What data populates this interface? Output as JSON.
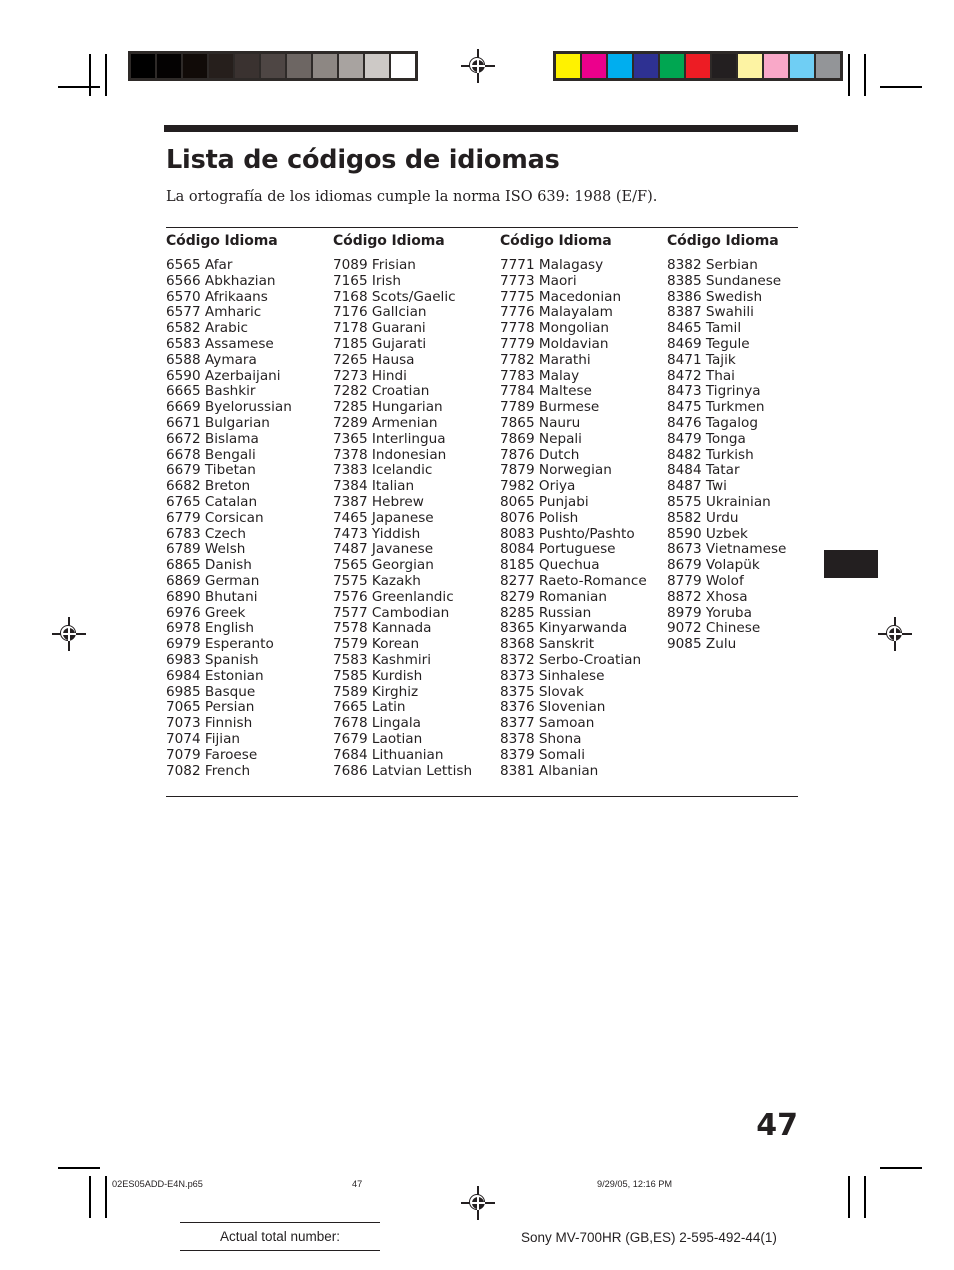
{
  "document": {
    "title": "Lista de códigos de idiomas",
    "intro": "La ortografía de los idiomas cumple la norma ISO 639: 1988 (E/F).",
    "folio": "47"
  },
  "table": {
    "headers": [
      "Código Idioma",
      "Código Idioma",
      "Código Idioma",
      "Código Idioma"
    ],
    "columns": [
      [
        "6565 Afar",
        "6566 Abkhazian",
        "6570 Afrikaans",
        "6577 Amharic",
        "6582 Arabic",
        "6583 Assamese",
        "6588 Aymara",
        "6590 Azerbaijani",
        "6665 Bashkir",
        "6669 Byelorussian",
        "6671 Bulgarian",
        "6672 Bislama",
        "6678 Bengali",
        "6679 Tibetan",
        "6682 Breton",
        "6765 Catalan",
        "6779 Corsican",
        "6783 Czech",
        "6789 Welsh",
        "6865 Danish",
        "6869 German",
        "6890 Bhutani",
        "6976 Greek",
        "6978 English",
        "6979 Esperanto",
        "6983 Spanish",
        "6984 Estonian",
        "6985 Basque",
        "7065 Persian",
        "7073 Finnish",
        "7074 Fijian",
        "7079 Faroese",
        "7082 French"
      ],
      [
        "7089 Frisian",
        "7165 Irish",
        "7168 Scots/Gaelic",
        "7176 Gallcian",
        "7178 Guarani",
        "7185 Gujarati",
        "7265 Hausa",
        "7273 Hindi",
        "7282 Croatian",
        "7285 Hungarian",
        "7289 Armenian",
        "7365 Interlingua",
        "7378 Indonesian",
        "7383 Icelandic",
        "7384 Italian",
        "7387 Hebrew",
        "7465 Japanese",
        "7473 Yiddish",
        "7487 Javanese",
        "7565 Georgian",
        "7575 Kazakh",
        "7576 Greenlandic",
        "7577 Cambodian",
        "7578 Kannada",
        "7579 Korean",
        "7583 Kashmiri",
        "7585 Kurdish",
        "7589 Kirghiz",
        "7665 Latin",
        "7678 Lingala",
        "7679 Laotian",
        "7684 Lithuanian",
        "7686 Latvian Lettish"
      ],
      [
        "7771 Malagasy",
        "7773 Maori",
        "7775 Macedonian",
        "7776 Malayalam",
        "7778 Mongolian",
        "7779 Moldavian",
        "7782 Marathi",
        "7783 Malay",
        "7784 Maltese",
        "7789 Burmese",
        "7865 Nauru",
        "7869 Nepali",
        "7876 Dutch",
        "7879 Norwegian",
        "7982 Oriya",
        "8065 Punjabi",
        "8076 Polish",
        "8083 Pushto/Pashto",
        "8084 Portuguese",
        "8185 Quechua",
        "8277 Raeto-Romance",
        "8279 Romanian",
        "8285 Russian",
        "8365 Kinyarwanda",
        "8368 Sanskrit",
        "8372 Serbo-Croatian",
        "8373 Sinhalese",
        "8375 Slovak",
        "8376 Slovenian",
        "8377 Samoan",
        "8378 Shona",
        "8379 Somali",
        "8381 Albanian"
      ],
      [
        "8382 Serbian",
        "8385 Sundanese",
        "8386 Swedish",
        "8387 Swahili",
        "8465 Tamil",
        "8469 Tegule",
        "8471 Tajik",
        "8472 Thai",
        "8473 Tigrinya",
        "8475 Turkmen",
        "8476 Tagalog",
        "8479 Tonga",
        "8482 Turkish",
        "8484 Tatar",
        "8487 Twi",
        "8575 Ukrainian",
        "8582 Urdu",
        "8590 Uzbek",
        "8673 Vietnamese",
        "8679 Volapük",
        "8779 Wolof",
        "8872 Xhosa",
        "8979 Yoruba",
        "9072 Chinese",
        "9085 Zulu"
      ]
    ]
  },
  "print_marks": {
    "grayscale_swatches": [
      "#000000",
      "#040202",
      "#110b08",
      "#261f1c",
      "#3a3230",
      "#4e4644",
      "#6d6663",
      "#8d8783",
      "#a8a3a0",
      "#cdc9c6",
      "#ffffff"
    ],
    "color_swatches": [
      "#fff200",
      "#ec008c",
      "#00aeef",
      "#2e3192",
      "#00a651",
      "#ed1c24",
      "#231f20",
      "#fdf3a3",
      "#f9a8c8",
      "#6fcef4",
      "#939598"
    ],
    "registration_mark_name": "registration-target"
  },
  "slug": {
    "file_name": "02ES05ADD-E4N.p65",
    "page_number": "47",
    "date_time": "9/29/05, 12:16 PM"
  },
  "footer": {
    "actual_total_label": "Actual total number:",
    "model_line": "Sony MV-700HR (GB,ES) 2-595-492-44(1)"
  }
}
